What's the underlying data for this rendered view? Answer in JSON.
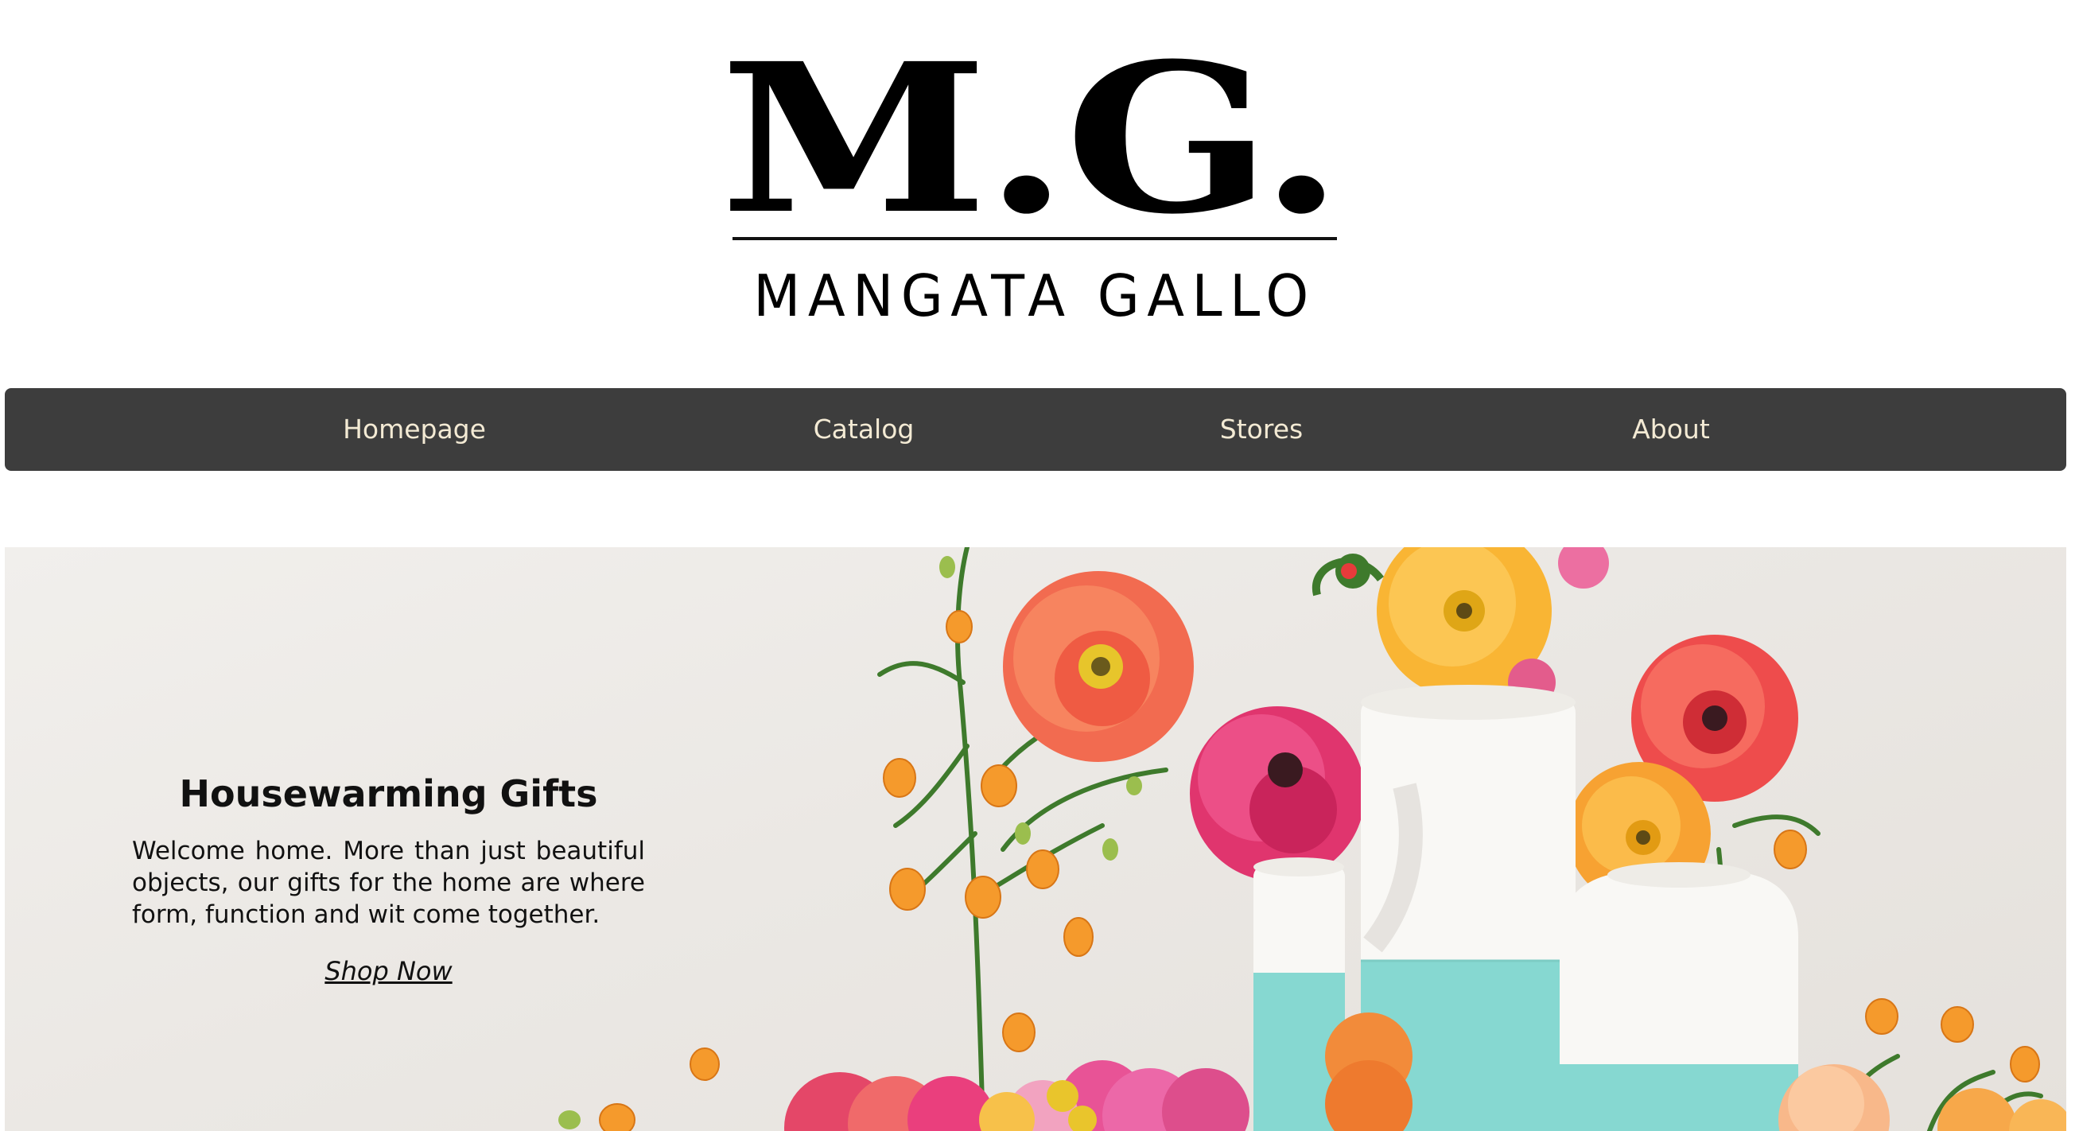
{
  "brand": {
    "monogram": "M.G.",
    "name": "MANGATA GALLO"
  },
  "nav": {
    "items": [
      {
        "label": "Homepage"
      },
      {
        "label": "Catalog"
      },
      {
        "label": "Stores"
      },
      {
        "label": "About"
      }
    ]
  },
  "hero": {
    "title": "Housewarming Gifts",
    "description": "Welcome home. More than just beautiful objects, our gifts for the home are where form, function and wit come together.",
    "cta_label": "Shop Now"
  },
  "colors": {
    "nav_background": "#3d3d3d",
    "nav_text": "#f3ead4",
    "vase_teal": "#86d8d1",
    "vase_white": "#f9f8f5"
  }
}
